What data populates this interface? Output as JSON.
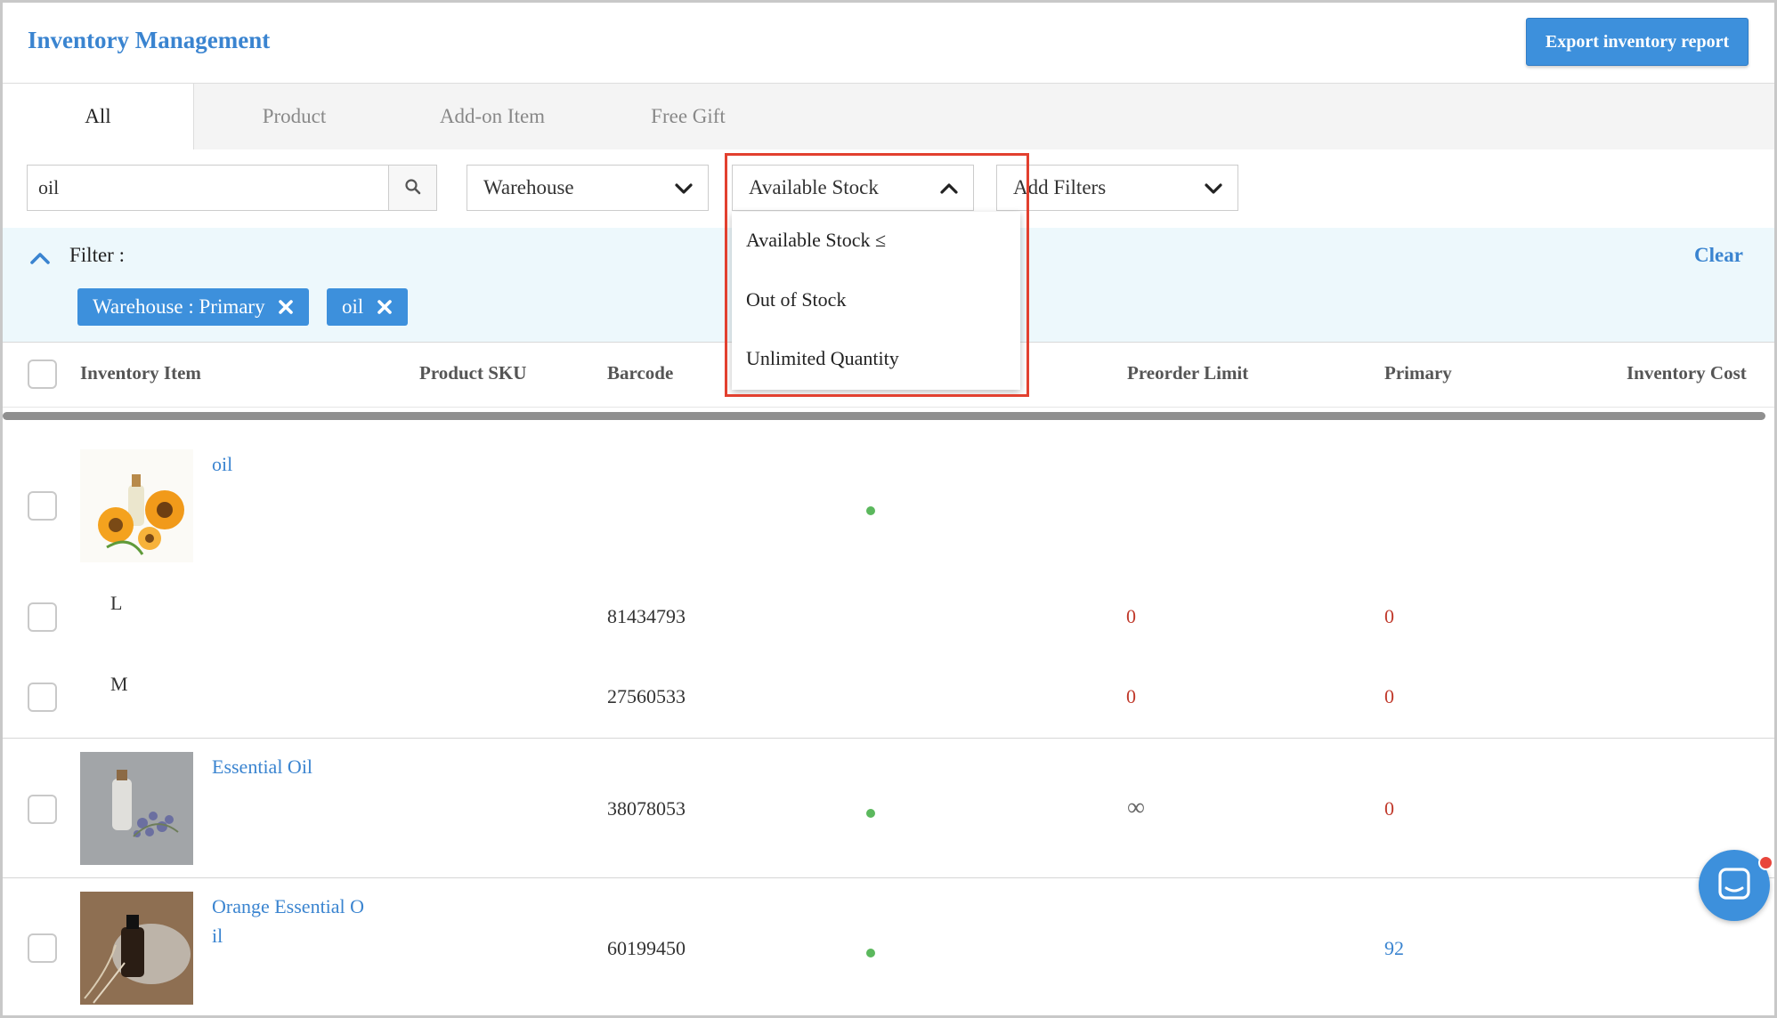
{
  "header": {
    "title": "Inventory Management",
    "export_label": "Export inventory report"
  },
  "tabs": [
    {
      "label": "All"
    },
    {
      "label": "Product"
    },
    {
      "label": "Add-on Item"
    },
    {
      "label": "Free Gift"
    }
  ],
  "search": {
    "value": "oil"
  },
  "filters": {
    "warehouse": "Warehouse",
    "available_stock": "Available Stock",
    "add_filters": "Add Filters"
  },
  "filter_panel": {
    "label": "Filter :",
    "clear": "Clear",
    "chips": [
      "Warehouse : Primary",
      "oil"
    ]
  },
  "dropdown": {
    "items": [
      "Available Stock ≤",
      "Out of Stock",
      "Unlimited Quantity"
    ]
  },
  "table": {
    "columns": [
      "Inventory Item",
      "Product SKU",
      "Barcode",
      "Preorder Limit",
      "Primary",
      "Inventory Cost"
    ],
    "rows": [
      {
        "name": "oil",
        "barcode": "",
        "preorder": "",
        "primary": ""
      },
      {
        "name": "L",
        "barcode": "81434793",
        "preorder": "0",
        "primary": "0"
      },
      {
        "name": "M",
        "barcode": "27560533",
        "preorder": "0",
        "primary": "0"
      },
      {
        "name": "Essential Oil",
        "barcode": "38078053",
        "preorder": "∞",
        "primary": "0"
      },
      {
        "name": "Orange Essential O",
        "name2": "il",
        "barcode": "60199450",
        "preorder": "",
        "primary": "92"
      }
    ]
  },
  "colors": {
    "accent": "#3d90dc",
    "title": "#3a84d0",
    "highlight": "#e2402f",
    "status_dot": "#5bb85d",
    "zero": "#c0392b"
  },
  "icons": [
    "search-icon",
    "chevron-down-icon",
    "chevron-up-icon",
    "close-icon",
    "chat-icon"
  ]
}
